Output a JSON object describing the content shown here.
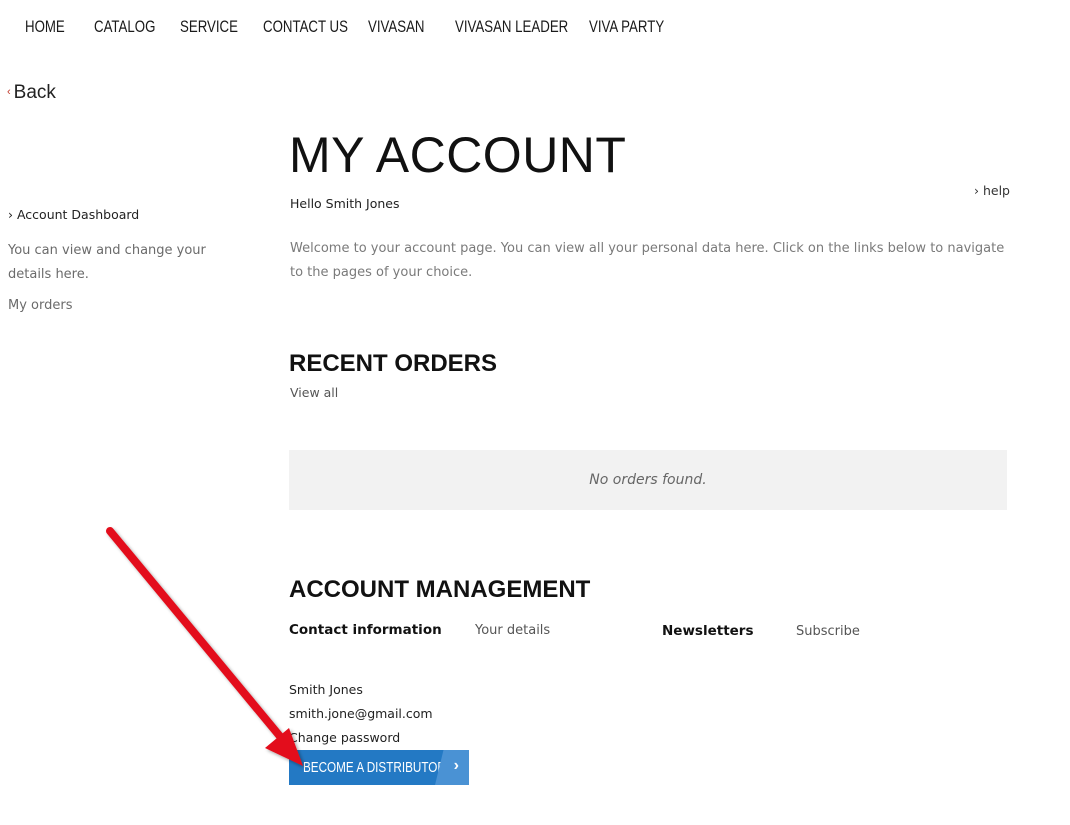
{
  "nav": {
    "items": [
      "HOME",
      "CATALOG",
      "SERVICE",
      "CONTACT US",
      "VIVASAN",
      "VIVASAN LEADER",
      "VIVA PARTY"
    ]
  },
  "back": {
    "chevron": "‹",
    "label": "Back"
  },
  "sidebar": {
    "dashboard": "› Account Dashboard",
    "description": "You can view and change your details here.",
    "orders": "My orders"
  },
  "main": {
    "title": "MY ACCOUNT",
    "help": "› help",
    "greeting": "Hello Smith Jones",
    "welcome": "Welcome to your account page. You can view all your personal data here. Click on the links below to navigate to the pages of your choice."
  },
  "recent_orders": {
    "title": "RECENT ORDERS",
    "view_all": "View all",
    "empty_message": "No orders found."
  },
  "account_management": {
    "title": "ACCOUNT MANAGEMENT",
    "contact_label": "Contact information",
    "your_details": "Your details",
    "newsletters_label": "Newsletters",
    "subscribe": "Subscribe",
    "name": "Smith Jones",
    "email": "smith.jone@gmail.com",
    "change_password": "Change password",
    "distributor_button": "BECOME A DISTRIBUTOR",
    "distributor_arrow": "›"
  },
  "colors": {
    "button": "#2379c4",
    "button_arrow": "#4a92d4",
    "annotation_arrow": "#e3111b",
    "empty_box": "#f2f2f2"
  }
}
